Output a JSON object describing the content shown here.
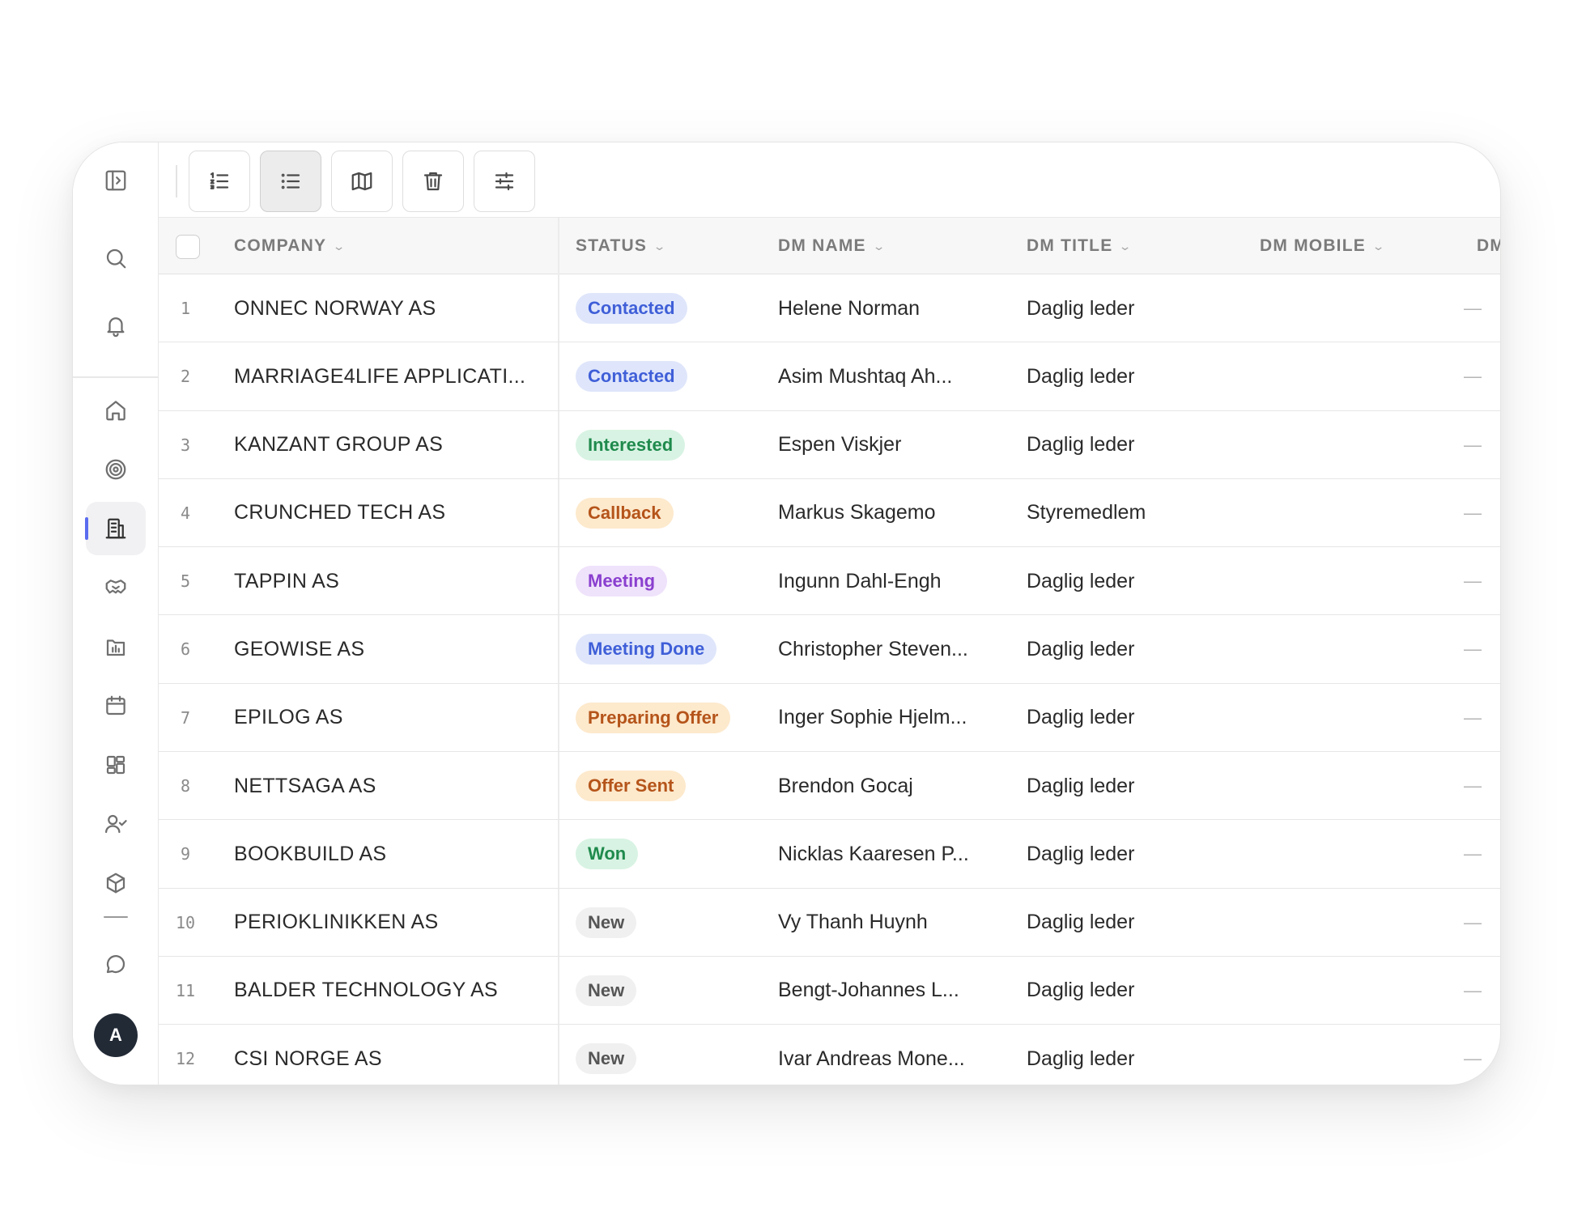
{
  "colors": {
    "accent": "#5b6cf0",
    "status": {
      "Contacted": {
        "bg": "#dfe6fb",
        "fg": "#3f5fd8"
      },
      "Interested": {
        "bg": "#d8f3e3",
        "fg": "#1f8a4c"
      },
      "Callback": {
        "bg": "#fde9cc",
        "fg": "#b5541a"
      },
      "Meeting": {
        "bg": "#efe2fb",
        "fg": "#8a3fcf"
      },
      "Meeting Done": {
        "bg": "#dfe6fb",
        "fg": "#3f5fd8"
      },
      "Preparing Offer": {
        "bg": "#fde9cc",
        "fg": "#b5541a"
      },
      "Offer Sent": {
        "bg": "#fde9cc",
        "fg": "#b5541a"
      },
      "Won": {
        "bg": "#d8f3e3",
        "fg": "#1f8a4c"
      },
      "New": {
        "bg": "#f0f0f0",
        "fg": "#555555"
      }
    }
  },
  "sidebar": {
    "icons": [
      "sidebar-toggle-icon",
      "search-icon",
      "bell-icon",
      "home-icon",
      "target-icon",
      "building-icon",
      "handshake-icon",
      "chart-icon",
      "calendar-icon",
      "grid-icon",
      "user-check-icon",
      "box-icon",
      "chat-icon"
    ],
    "active": "building-icon",
    "avatar_initial": "A"
  },
  "toolbar": {
    "buttons": [
      "ordered-list-icon",
      "list-icon",
      "map-icon",
      "trash-icon",
      "sliders-icon"
    ],
    "active": "list-icon"
  },
  "table": {
    "columns": [
      "COMPANY",
      "STATUS",
      "DM NAME",
      "DM TITLE",
      "DM MOBILE",
      "DM"
    ],
    "rows": [
      {
        "num": "1",
        "company": "ONNEC NORWAY AS",
        "status": "Contacted",
        "name": "Helene Norman",
        "title": "Daglig leder",
        "dash": "—"
      },
      {
        "num": "2",
        "company": "MARRIAGE4LIFE APPLICATI...",
        "status": "Contacted",
        "name": "Asim Mushtaq Ah...",
        "title": "Daglig leder",
        "dash": "—"
      },
      {
        "num": "3",
        "company": "KANZANT GROUP AS",
        "status": "Interested",
        "name": "Espen Viskjer",
        "title": "Daglig leder",
        "dash": "—"
      },
      {
        "num": "4",
        "company": "CRUNCHED TECH AS",
        "status": "Callback",
        "name": "Markus Skagemo",
        "title": "Styremedlem",
        "dash": "—"
      },
      {
        "num": "5",
        "company": "TAPPIN AS",
        "status": "Meeting",
        "name": "Ingunn Dahl-Engh",
        "title": "Daglig leder",
        "dash": "—"
      },
      {
        "num": "6",
        "company": "GEOWISE AS",
        "status": "Meeting Done",
        "name": "Christopher Steven...",
        "title": "Daglig leder",
        "dash": "—"
      },
      {
        "num": "7",
        "company": "EPILOG AS",
        "status": "Preparing Offer",
        "name": "Inger Sophie Hjelm...",
        "title": "Daglig leder",
        "dash": "—"
      },
      {
        "num": "8",
        "company": "NETTSAGA AS",
        "status": "Offer Sent",
        "name": "Brendon Gocaj",
        "title": "Daglig leder",
        "dash": "—"
      },
      {
        "num": "9",
        "company": "BOOKBUILD AS",
        "status": "Won",
        "name": "Nicklas Kaaresen P...",
        "title": "Daglig leder",
        "dash": "—"
      },
      {
        "num": "10",
        "company": "PERIOKLINIKKEN AS",
        "status": "New",
        "name": "Vy Thanh Huynh",
        "title": "Daglig leder",
        "dash": "—"
      },
      {
        "num": "11",
        "company": "BALDER TECHNOLOGY AS",
        "status": "New",
        "name": "Bengt-Johannes L...",
        "title": "Daglig leder",
        "dash": "—"
      },
      {
        "num": "12",
        "company": "CSI NORGE AS",
        "status": "New",
        "name": "Ivar Andreas Mone...",
        "title": "Daglig leder",
        "dash": "—"
      }
    ]
  }
}
